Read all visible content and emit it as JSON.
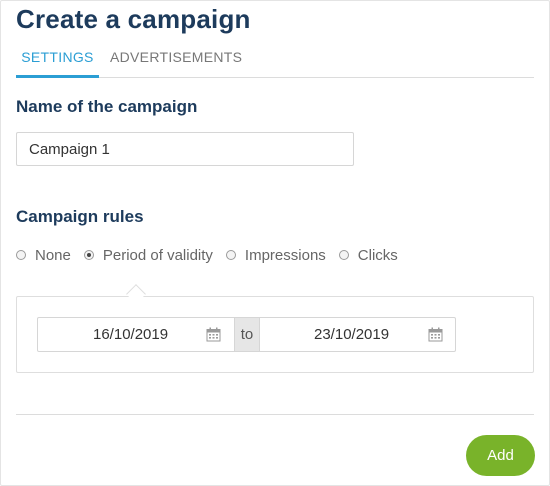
{
  "page": {
    "title": "Create a campaign"
  },
  "tabs": [
    {
      "label": "SETTINGS",
      "active": true
    },
    {
      "label": "ADVERTISEMENTS",
      "active": false
    }
  ],
  "form": {
    "name_label": "Name of the campaign",
    "name_value": "Campaign 1",
    "rules_label": "Campaign rules",
    "rules_options": [
      {
        "label": "None",
        "checked": false
      },
      {
        "label": "Period of validity",
        "checked": true
      },
      {
        "label": "Impressions",
        "checked": false
      },
      {
        "label": "Clicks",
        "checked": false
      }
    ],
    "date_range": {
      "from": "16/10/2019",
      "separator": "to",
      "to": "23/10/2019",
      "icon": "calendar-icon"
    }
  },
  "actions": {
    "add_label": "Add"
  },
  "colors": {
    "title": "#1d3b5c",
    "tab_active": "#2b9ed4",
    "add_button": "#79b32a"
  }
}
